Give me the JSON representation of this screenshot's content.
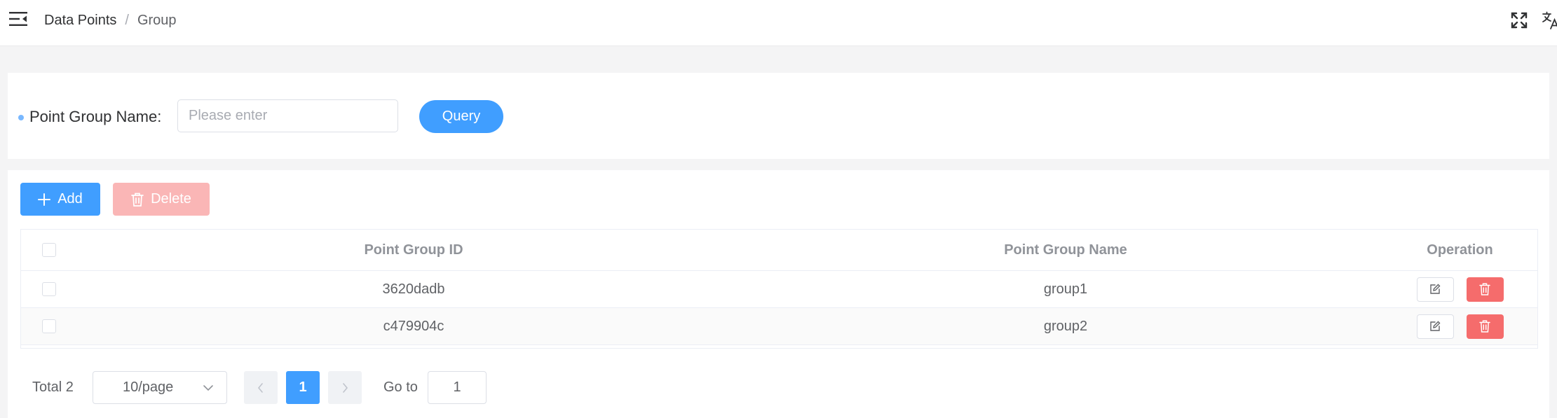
{
  "header": {
    "breadcrumb": [
      {
        "label": "Data Points"
      },
      {
        "label": "Group"
      }
    ],
    "separator": "/",
    "icons": [
      "menu-fold-icon",
      "fullscreen-icon",
      "translate-icon"
    ]
  },
  "search": {
    "label": "Point Group Name:",
    "placeholder": "Please enter",
    "value": "",
    "query_label": "Query"
  },
  "toolbar": {
    "add_label": "Add",
    "delete_label": "Delete"
  },
  "table": {
    "columns": [
      "Point Group ID",
      "Point Group Name",
      "Operation"
    ],
    "rows": [
      {
        "id": "3620dadb",
        "name": "group1"
      },
      {
        "id": "c479904c",
        "name": "group2"
      }
    ]
  },
  "pagination": {
    "total_label": "Total 2",
    "page_size": "10/page",
    "current_page": "1",
    "goto_label": "Go to",
    "goto_value": "1"
  },
  "colors": {
    "primary": "#409eff",
    "danger": "#f56c6c",
    "danger_disabled": "#fab6b6",
    "background": "#f4f4f5"
  }
}
